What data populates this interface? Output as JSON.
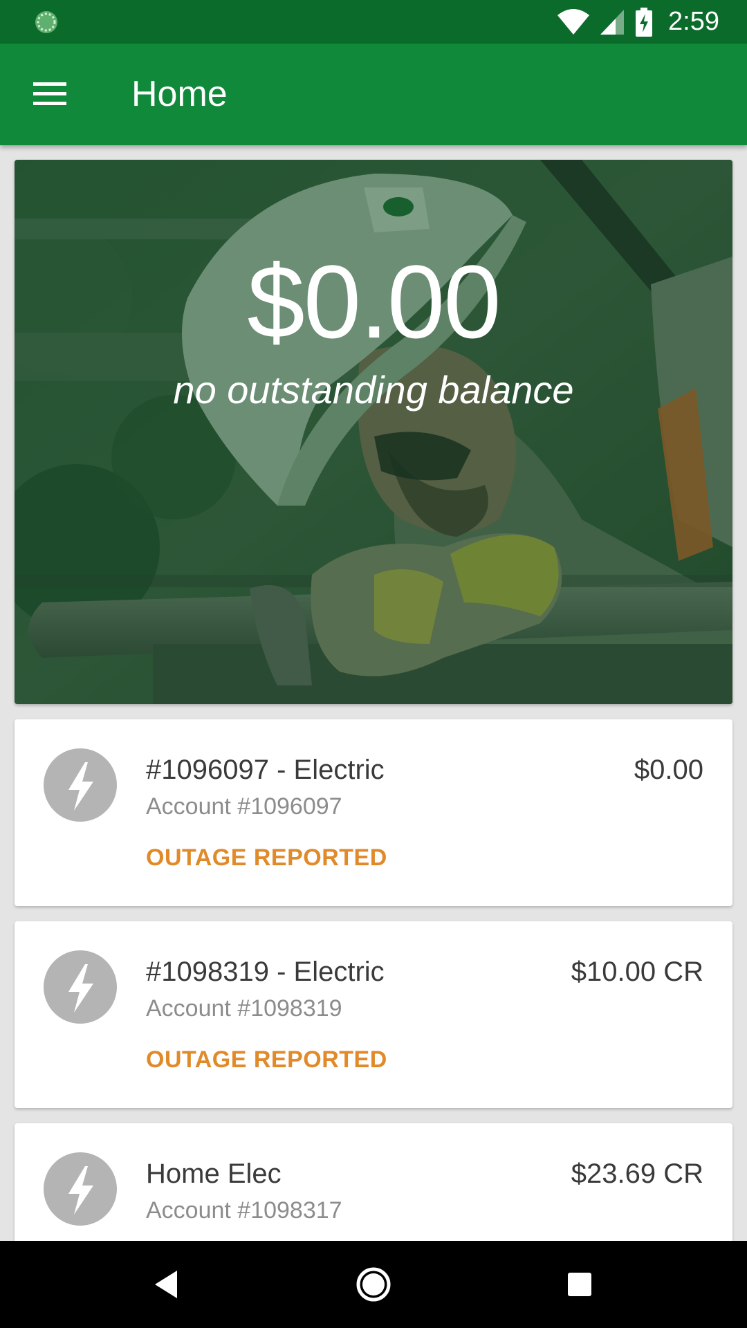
{
  "status_bar": {
    "time": "2:59",
    "icons": [
      "sync-icon",
      "wifi-icon",
      "cellular-signal-icon",
      "battery-charging-icon"
    ]
  },
  "app_bar": {
    "title": "Home",
    "menu_icon": "hamburger-menu-icon"
  },
  "hero": {
    "amount": "$0.00",
    "caption": "no outstanding balance"
  },
  "accounts": [
    {
      "name": "#1096097 - Electric",
      "number": "Account #1096097",
      "balance": "$0.00",
      "status": "OUTAGE REPORTED",
      "icon": "lightning-bolt-icon"
    },
    {
      "name": "#1098319 - Electric",
      "number": "Account #1098319",
      "balance": "$10.00 CR",
      "status": "OUTAGE REPORTED",
      "icon": "lightning-bolt-icon"
    },
    {
      "name": "Home Elec",
      "number": "Account #1098317",
      "balance": "$23.69 CR",
      "status": "",
      "icon": "lightning-bolt-icon"
    }
  ],
  "nav_bar": {
    "buttons": [
      "back-icon",
      "home-icon",
      "recents-icon"
    ]
  },
  "colors": {
    "status_bar": "#0b6b2b",
    "app_bar": "#10893a",
    "status_text": "#e08a2a",
    "icon_circle": "#b4b4b4"
  }
}
